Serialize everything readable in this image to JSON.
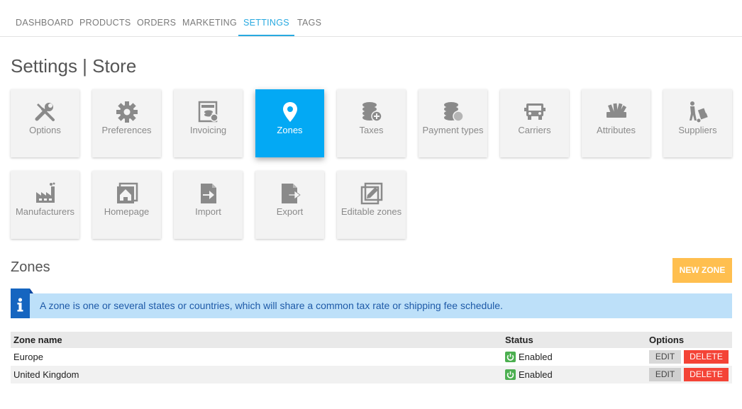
{
  "nav": {
    "tabs": [
      {
        "label": "DASHBOARD",
        "active": false
      },
      {
        "label": "PRODUCTS",
        "active": false
      },
      {
        "label": "ORDERS",
        "active": false
      },
      {
        "label": "MARKETING",
        "active": false
      },
      {
        "label": "SETTINGS",
        "active": true
      },
      {
        "label": "TAGS",
        "active": false
      }
    ]
  },
  "page": {
    "title": "Settings | Store"
  },
  "tiles": [
    {
      "label": "Options",
      "icon": "tools-icon",
      "active": false
    },
    {
      "label": "Preferences",
      "icon": "gear-icon",
      "active": false
    },
    {
      "label": "Invoicing",
      "icon": "invoice-icon",
      "active": false
    },
    {
      "label": "Zones",
      "icon": "map-pin-icon",
      "active": true
    },
    {
      "label": "Taxes",
      "icon": "coins-plus-icon",
      "active": false
    },
    {
      "label": "Payment types",
      "icon": "coins-icon",
      "active": false
    },
    {
      "label": "Carriers",
      "icon": "truck-icon",
      "active": false
    },
    {
      "label": "Attributes",
      "icon": "swatches-icon",
      "active": false
    },
    {
      "label": "Suppliers",
      "icon": "hand-truck-icon",
      "active": false
    },
    {
      "label": "Manufacturers",
      "icon": "factory-icon",
      "active": false
    },
    {
      "label": "Homepage",
      "icon": "home-icon",
      "active": false
    },
    {
      "label": "Import",
      "icon": "import-icon",
      "active": false
    },
    {
      "label": "Export",
      "icon": "export-icon",
      "active": false
    },
    {
      "label": "Editable zones",
      "icon": "edit-box-icon",
      "active": false
    }
  ],
  "zones": {
    "title": "Zones",
    "new_button": "NEW ZONE",
    "info": "A zone is one or several states or countries, which will share a common tax rate or shipping fee schedule.",
    "columns": {
      "name": "Zone name",
      "status": "Status",
      "options": "Options"
    },
    "rows": [
      {
        "name": "Europe",
        "status": "Enabled",
        "edit": "EDIT",
        "delete": "DELETE"
      },
      {
        "name": "United Kingdom",
        "status": "Enabled",
        "edit": "EDIT",
        "delete": "DELETE"
      }
    ]
  },
  "colors": {
    "accent": "#03a9f4",
    "new_button": "#ffbf4f",
    "delete": "#f44336",
    "enabled": "#4caf50",
    "info_bg": "#bde0f9"
  }
}
